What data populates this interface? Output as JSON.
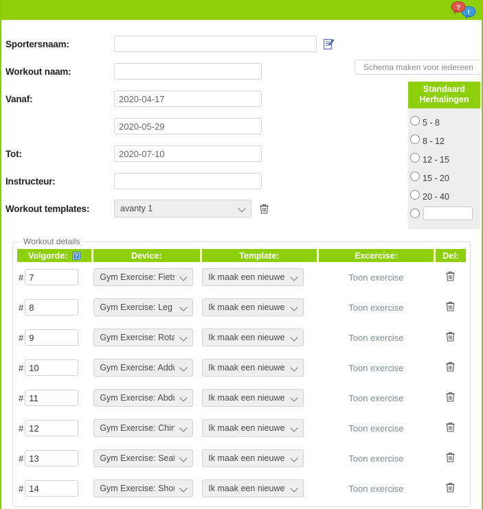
{
  "topbar": {
    "help_icon": "question-bubble-icon",
    "info_icon": "info-bubble-icon"
  },
  "form": {
    "sportersnaam_label": "Sportersnaam:",
    "sportersnaam_value": "",
    "sportersnaam_edit_icon": "edit-document-icon",
    "workout_naam_label": "Workout naam:",
    "workout_naam_value": "",
    "vanaf_label": "Vanaf:",
    "vanaf_value": "2020-04-17",
    "vanaf_second_value": "2020-05-29",
    "tot_label": "Tot:",
    "tot_value": "2020-07-10",
    "instructeur_label": "Instructeur:",
    "instructeur_value": "",
    "workout_templates_label": "Workout templates:",
    "workout_templates_value": "avanty 1",
    "workout_templates_delete_icon": "trash-icon"
  },
  "schema_button": {
    "label": "Schema maken voor iedereen"
  },
  "reps_panel": {
    "title_line1": "Standaard",
    "title_line2": "Herhalingen",
    "options": [
      {
        "label": "5 - 8",
        "selected": false
      },
      {
        "label": "8 - 12",
        "selected": false
      },
      {
        "label": "12 - 15",
        "selected": false
      },
      {
        "label": "15 - 20",
        "selected": false
      },
      {
        "label": "20 - 40",
        "selected": false
      }
    ],
    "custom_value": "",
    "custom_placeholder": ""
  },
  "workout_details": {
    "legend": "Workout details",
    "columns": {
      "volgorde": "Volgorde:",
      "device": "Device:",
      "template": "Template:",
      "exercise": "Excercise:",
      "del": "Del:"
    },
    "volgorde_help_icon": "help-question-icon",
    "row_prefix": "#",
    "exercise_link_label": "Toon exercise",
    "delete_icon": "trash-icon",
    "rows": [
      {
        "order": "7",
        "device": "Gym Exercise: Fiets",
        "template": "Ik maak een nieuwe"
      },
      {
        "order": "8",
        "device": "Gym Exercise: Leg Curl",
        "template": "Ik maak een nieuwe"
      },
      {
        "order": "9",
        "device": "Gym Exercise: Rotary",
        "template": "Ik maak een nieuwe"
      },
      {
        "order": "10",
        "device": "Gym Exercise: Adductor",
        "template": "Ik maak een nieuwe"
      },
      {
        "order": "11",
        "device": "Gym Exercise: Abductor",
        "template": "Ik maak een nieuwe"
      },
      {
        "order": "12",
        "device": "Gym Exercise: Chin Up",
        "template": "Ik maak een nieuwe"
      },
      {
        "order": "13",
        "device": "Gym Exercise: Seated",
        "template": "Ik maak een nieuwe"
      },
      {
        "order": "14",
        "device": "Gym Exercise: Shoulder",
        "template": "Ik maak een nieuwe"
      }
    ]
  },
  "colors": {
    "brand_green": "#8DCF0B",
    "panel_gray": "#eeeeee",
    "link_gray": "#7c8b94"
  }
}
